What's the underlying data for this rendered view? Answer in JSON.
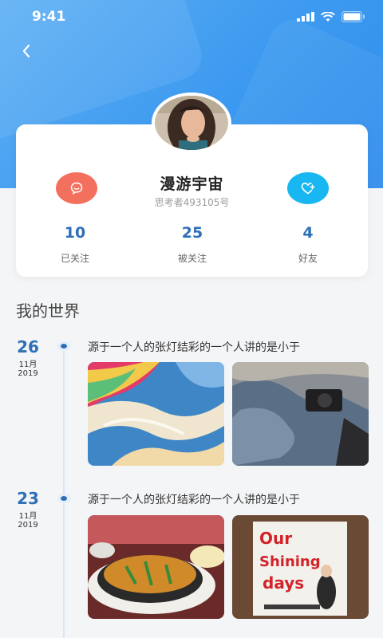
{
  "status": {
    "time": "9:41"
  },
  "profile": {
    "name": "漫游宇宙",
    "subtitle": "思考者493105号",
    "stats": [
      {
        "value": "10",
        "label": "已关注"
      },
      {
        "value": "25",
        "label": "被关注"
      },
      {
        "value": "4",
        "label": "好友"
      }
    ],
    "accent_message": "#f2705d",
    "accent_favorite": "#18b7f1",
    "accent_numbers": "#2f6fb6"
  },
  "section": {
    "title": "我的世界"
  },
  "timeline": [
    {
      "day": "26",
      "month": "11月",
      "year": "2019",
      "text": "源于一个人的张灯结彩的一个人讲的是小于"
    },
    {
      "day": "23",
      "month": "11月",
      "year": "2019",
      "text": "源于一个人的张灯结彩的一个人讲的是小于"
    }
  ],
  "icons": {
    "back": "chevron-left-icon",
    "message": "chat-bubble-icon",
    "favorite": "heart-plus-icon"
  }
}
